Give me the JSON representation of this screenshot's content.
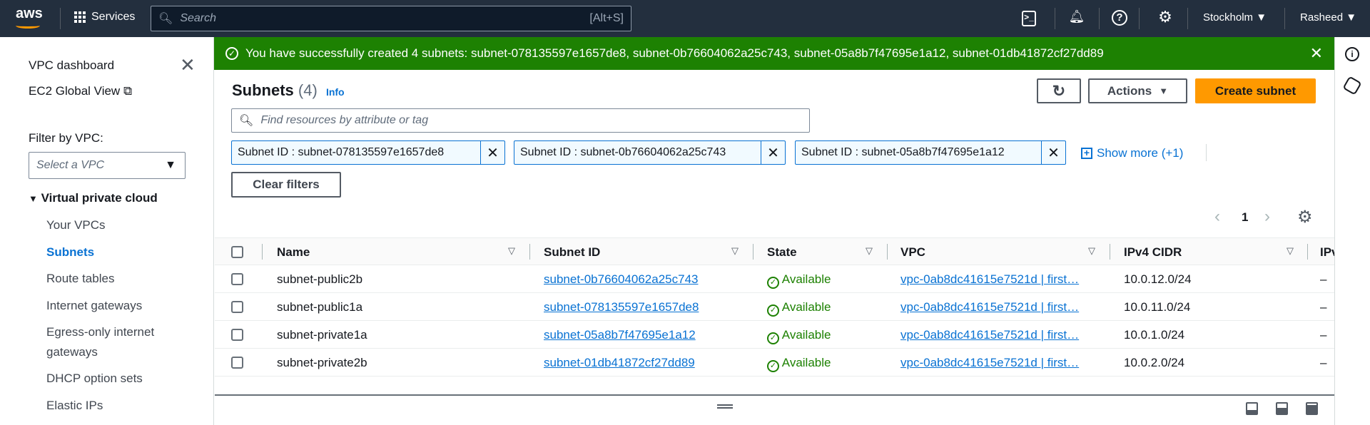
{
  "topbar": {
    "logo": "aws",
    "services": "Services",
    "search_placeholder": "Search",
    "search_shortcut": "[Alt+S]",
    "region": "Stockholm",
    "user": "Rasheed"
  },
  "banner": {
    "message": "You have successfully created 4 subnets: subnet-078135597e1657de8, subnet-0b76604062a25c743, subnet-05a8b7f47695e1a12, subnet-01db41872cf27dd89"
  },
  "sidebar": {
    "dashboard": "VPC dashboard",
    "global_view": "EC2 Global View",
    "filter_label": "Filter by VPC:",
    "select_placeholder": "Select a VPC",
    "section": "Virtual private cloud",
    "items": [
      "Your VPCs",
      "Subnets",
      "Route tables",
      "Internet gateways",
      "Egress-only internet",
      "gateways",
      "DHCP option sets",
      "Elastic IPs"
    ]
  },
  "main": {
    "title": "Subnets",
    "count": "(4)",
    "info": "Info",
    "actions": "Actions",
    "create": "Create subnet",
    "filter_placeholder": "Find resources by attribute or tag",
    "tokens": [
      "Subnet ID : subnet-078135597e1657de8",
      "Subnet ID : subnet-0b76604062a25c743",
      "Subnet ID : subnet-05a8b7f47695e1a12"
    ],
    "show_more": "Show more (+1)",
    "clear": "Clear filters",
    "page": "1"
  },
  "table": {
    "headers": [
      "Name",
      "Subnet ID",
      "State",
      "VPC",
      "IPv4 CIDR",
      "IPv"
    ],
    "rows": [
      {
        "name": "subnet-public2b",
        "id": "subnet-0b76604062a25c743",
        "state": "Available",
        "vpc": "vpc-0ab8dc41615e7521d | first…",
        "cidr": "10.0.12.0/24",
        "ipv6": "–"
      },
      {
        "name": "subnet-public1a",
        "id": "subnet-078135597e1657de8",
        "state": "Available",
        "vpc": "vpc-0ab8dc41615e7521d | first…",
        "cidr": "10.0.11.0/24",
        "ipv6": "–"
      },
      {
        "name": "subnet-private1a",
        "id": "subnet-05a8b7f47695e1a12",
        "state": "Available",
        "vpc": "vpc-0ab8dc41615e7521d | first…",
        "cidr": "10.0.1.0/24",
        "ipv6": "–"
      },
      {
        "name": "subnet-private2b",
        "id": "subnet-01db41872cf27dd89",
        "state": "Available",
        "vpc": "vpc-0ab8dc41615e7521d | first…",
        "cidr": "10.0.2.0/24",
        "ipv6": "–"
      }
    ]
  }
}
